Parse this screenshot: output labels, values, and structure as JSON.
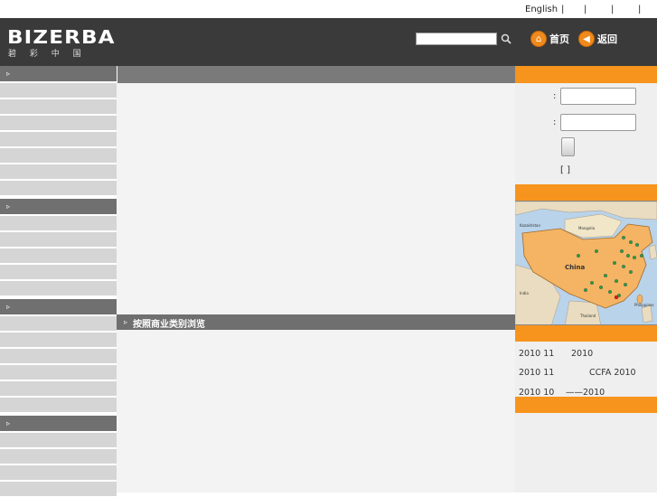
{
  "topbar": {
    "language": "English",
    "separators": [
      "|",
      "|",
      "|",
      "|"
    ]
  },
  "header": {
    "logo": "BIZERBA",
    "logo_sub": "碧 彩 中 国",
    "search_placeholder": "",
    "home_label": "首页",
    "back_label": "返回"
  },
  "sidebar": {
    "section_arrow": "▹",
    "sections": [
      {
        "title": "",
        "items": [
          "",
          "",
          "",
          "",
          "",
          "",
          ""
        ]
      },
      {
        "title": "",
        "items": [
          "",
          "",
          "",
          "",
          "",
          ""
        ]
      },
      {
        "title": "",
        "items": [
          "",
          "",
          "",
          "",
          "",
          "",
          ""
        ]
      },
      {
        "title": "",
        "items": [
          "",
          "",
          "",
          "",
          ""
        ]
      }
    ]
  },
  "center": {
    "header_title": "",
    "browse_bar_label": "按照商业类别浏览"
  },
  "login": {
    "username_colon": ":",
    "password_colon": ":",
    "brackets": "[  ]"
  },
  "map": {
    "country_label": "China",
    "labels": [
      "Mongolia",
      "India",
      "Thailand",
      "Philippines",
      "Kazakhstan"
    ]
  },
  "news": [
    {
      "date": "2010 11",
      "title": "2010"
    },
    {
      "date": "2010 11",
      "title": "CCFA 2010"
    },
    {
      "date": "2010 10",
      "title": "——2010"
    }
  ],
  "colors": {
    "accent": "#f7941d",
    "header_bg": "#3a3a3a",
    "sidebar_head": "#707070",
    "sidebar_item": "#d5d5d5"
  }
}
